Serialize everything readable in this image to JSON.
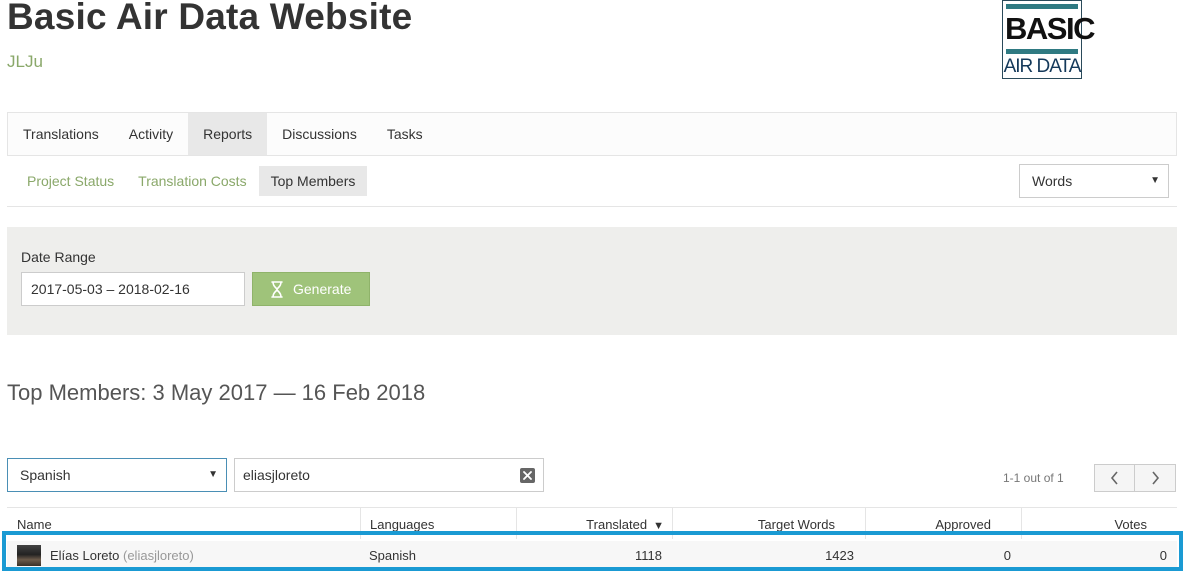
{
  "header": {
    "title": "Basic Air Data Website",
    "owner": "JLJu",
    "logo": {
      "line1": "BASIC",
      "line2": "AIR DATA"
    }
  },
  "nav": {
    "tabs": [
      {
        "label": "Translations"
      },
      {
        "label": "Activity"
      },
      {
        "label": "Reports",
        "active": true
      },
      {
        "label": "Discussions"
      },
      {
        "label": "Tasks"
      }
    ]
  },
  "subnav": {
    "items": [
      {
        "label": "Project Status"
      },
      {
        "label": "Translation Costs"
      },
      {
        "label": "Top Members",
        "active": true
      }
    ],
    "unit_select": {
      "value": "Words"
    }
  },
  "filters": {
    "date_range_label": "Date Range",
    "date_range_value": "2017-05-03 – 2018-02-16",
    "generate_label": "Generate"
  },
  "report": {
    "heading": "Top Members: 3 May 2017 — 16 Feb 2018",
    "language_select": {
      "value": "Spanish"
    },
    "search_value": "eliasjloreto",
    "paging_text": "1-1 out of 1",
    "columns": {
      "name": "Name",
      "languages": "Languages",
      "translated": "Translated",
      "target_words": "Target Words",
      "approved": "Approved",
      "votes": "Votes"
    },
    "sort_column": "translated",
    "rows": [
      {
        "name": "Elías Loreto",
        "username": "(eliasjloreto)",
        "languages": "Spanish",
        "translated": "1118",
        "target_words": "1423",
        "approved": "0",
        "votes": "0"
      }
    ]
  },
  "colors": {
    "accent_green": "#8aa86a",
    "button_green": "#9fc37a",
    "highlight_blue": "#1a9ad3"
  }
}
